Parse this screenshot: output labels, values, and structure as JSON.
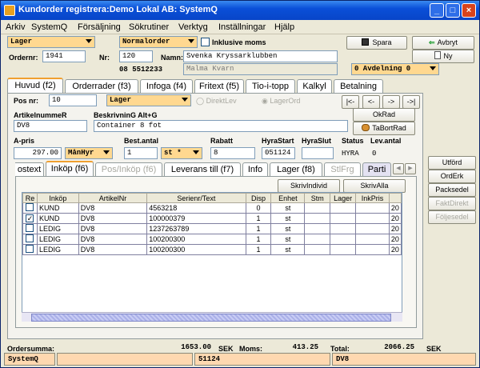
{
  "window": {
    "title": "Kundorder registrera:Demo Lokal AB: SystemQ",
    "buttons": [
      "_",
      "□",
      "×"
    ]
  },
  "menu": [
    "Arkiv",
    "SystemQ",
    "Försäljning",
    "Sökrutiner",
    "Verktyg",
    "Inställningar",
    "Hjälp"
  ],
  "header": {
    "lager_combo": "Lager",
    "order_type_combo": "Normalorder",
    "inkl_moms_label": "Inklusive moms",
    "ordernr_label": "Ordernr:",
    "ordernr": "1941",
    "nr_label": "Nr:",
    "nr": "120",
    "namn_label": "Namn:",
    "namn": "Svenka Kryssarklubben",
    "namn2": "Malma Kvarn",
    "phone": "08 5512233",
    "avdelning_combo": "0 Avdelning 0",
    "spara_label": "Spara",
    "avbryt_label": "Avbryt",
    "ny_label": "Ny"
  },
  "main_tabs": [
    "Huvud (f2)",
    "Orderrader (f3)",
    "Infoga (f4)",
    "Fritext (f5)",
    "Tio-i-topp",
    "Kalkyl",
    "Betalning"
  ],
  "row_edit": {
    "posnr_label": "Pos nr:",
    "posnr": "10",
    "lager_combo": "Lager",
    "direktlev_label": "DirektLev",
    "lagerord_label": "LagerOrd",
    "nav": [
      "|<-",
      "<-",
      "->",
      "->|"
    ],
    "artnr_label": "ArtikelnummeR",
    "artnr": "DV8",
    "beskr_label": "BeskrivninG Alt+G",
    "beskr": "Container 8 fot",
    "okrad_label": "OkRad",
    "tabortrad_label": "TaBortRad",
    "apris_label": "A-pris",
    "apris": "297.00",
    "hyra_combo": "MånHyr",
    "bestantal_label": "Best.antal",
    "bestantal": "1",
    "enhet_combo": "st *",
    "rabatt_label": "Rabatt",
    "rabatt": "8",
    "hyrastart_label": "HyraStart",
    "hyrastart": "051124",
    "hyraslut_label": "HyraSlut",
    "hyraslut": "",
    "status_label": "Status",
    "status": "HYRA",
    "levantal_label": "Lev.antal",
    "levantal": "0"
  },
  "sub_tabs": [
    "ostext",
    "Inköp (f6)",
    "Pos/Inköp (f6)",
    "Leverans till (f7)",
    "Info",
    "Lager  (f8)",
    "StlFrg",
    "Parti"
  ],
  "skrivindivid_label": "SkrivIndivid",
  "skrivalla_label": "SkrivAlla",
  "grid": {
    "columns": [
      "Re",
      "Inköp",
      "ArtikelNr",
      "Serienr/Text",
      "Disp",
      "Enhet",
      "Stm",
      "Lager",
      "InkPris",
      ""
    ],
    "rows": [
      {
        "checked": false,
        "inkop": "KUND",
        "art": "DV8",
        "serie": "4563218",
        "disp": "0",
        "enhet": "st",
        "last": "20"
      },
      {
        "checked": true,
        "inkop": "KUND",
        "art": "DV8",
        "serie": "100000379",
        "disp": "1",
        "enhet": "st",
        "last": "20"
      },
      {
        "checked": false,
        "inkop": "LEDIG",
        "art": "DV8",
        "serie": "1237263789",
        "disp": "1",
        "enhet": "st",
        "last": "20"
      },
      {
        "checked": false,
        "inkop": "LEDIG",
        "art": "DV8",
        "serie": "100200300",
        "disp": "1",
        "enhet": "st",
        "last": "20"
      },
      {
        "checked": false,
        "inkop": "LEDIG",
        "art": "DV8",
        "serie": "100200300",
        "disp": "1",
        "enhet": "st",
        "last": "20"
      }
    ]
  },
  "side_buttons": [
    "Utförd",
    "OrdErk",
    "Packsedel",
    "FaktDirekt",
    "Följesedel"
  ],
  "totals": {
    "ordersumma_label": "Ordersumma:",
    "ordersumma": "1653.00",
    "sek1": "SEK",
    "moms_label": "Moms:",
    "moms": "413.25",
    "total_label": "Total:",
    "total": "2066.25",
    "sek2": "SEK"
  },
  "statusbar": {
    "app": "SystemQ",
    "field": "51124",
    "art": "DV8"
  },
  "colors": {
    "title": "#0a4fd8",
    "combo": "#ffd890",
    "status": "#fed8b0"
  }
}
